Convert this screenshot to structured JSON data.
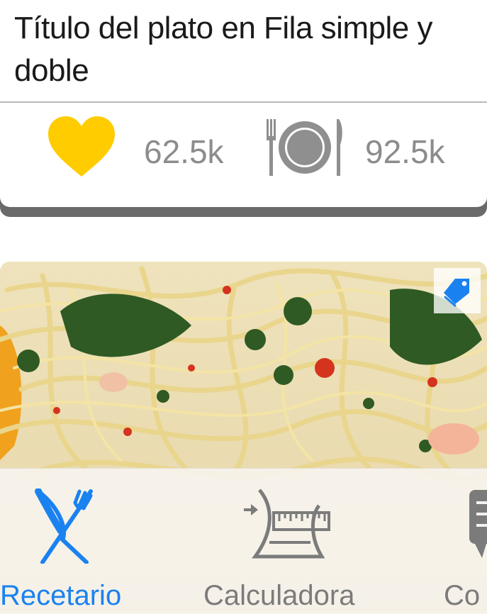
{
  "card": {
    "title": "Título del plato en Fila simple y doble",
    "likes": "62.5k",
    "servings": "92.5k"
  },
  "photo": {
    "tag_icon": "tag-icon"
  },
  "tabbar": {
    "tabs": [
      {
        "label": "Recetario",
        "icon": "fork-knife-icon",
        "active": true
      },
      {
        "label": "Calculadora",
        "icon": "scale-calculator-icon",
        "active": false
      },
      {
        "label": "Co",
        "icon": "chat-icon",
        "active": false
      }
    ]
  },
  "colors": {
    "accent": "#1a82f0",
    "heart": "#ffcc00",
    "inactive": "#7b7b7b"
  }
}
